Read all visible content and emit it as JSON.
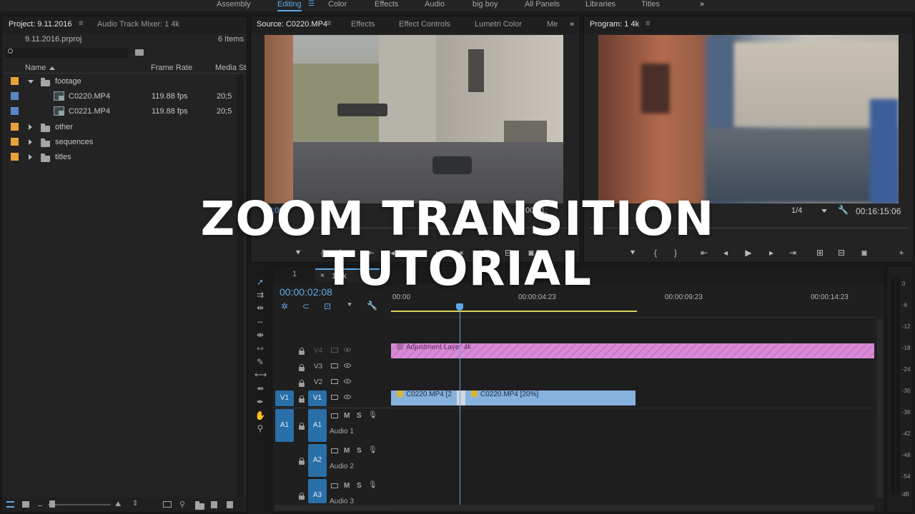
{
  "workspaces": [
    "Assembly",
    "Editing",
    "Color",
    "Effects",
    "Audio",
    "big boy",
    "All Panels",
    "Libraries",
    "Titles"
  ],
  "workspace_active": "Editing",
  "workspace_more": "»",
  "project_panel": {
    "tabs": [
      "Project: 9.11.2016",
      "Audio Track Mixer: 1 4k"
    ],
    "filename": "9.11.2016.prproj",
    "item_count": "6 Items",
    "columns": [
      "Name",
      "Frame Rate",
      "Media St"
    ],
    "items": [
      {
        "name": "footage",
        "type": "bin",
        "color": "#e8a23b",
        "expanded": true
      },
      {
        "name": "C0220.MP4",
        "type": "clip",
        "color": "#5b87c7",
        "fps": "119.88 fps",
        "media_start": "20;5"
      },
      {
        "name": "C0221.MP4",
        "type": "clip",
        "color": "#5b87c7",
        "fps": "119.88 fps",
        "media_start": "20;5"
      },
      {
        "name": "other",
        "type": "bin",
        "color": "#e8a23b"
      },
      {
        "name": "sequences",
        "type": "bin",
        "color": "#e8a23b"
      },
      {
        "name": "titles",
        "type": "bin",
        "color": "#e8a23b"
      }
    ]
  },
  "source_panel": {
    "tabs": [
      "Source: C0220.MP4",
      "Effects",
      "Effect Controls",
      "Lumetri Color",
      "Me"
    ],
    "timecode_left": "00;00;0",
    "timecode_mid": "00;01;"
  },
  "program_panel": {
    "title": "Program: 1 4k",
    "zoom": "1/4",
    "timecode": "00:16:15:06"
  },
  "timeline": {
    "tabs": [
      "1",
      "1 4k"
    ],
    "playhead_timecode": "00:00:02:08",
    "ruler": [
      "00:00",
      "00:00:04:23",
      "00:00:09:23",
      "00:00:14:23"
    ],
    "video_tracks": [
      "V4",
      "V3",
      "V2",
      "V1"
    ],
    "audio_tracks": [
      {
        "id": "A1",
        "name": "Audio 1"
      },
      {
        "id": "A2",
        "name": "Audio 2"
      },
      {
        "id": "A3",
        "name": "Audio 3"
      }
    ],
    "source_patch": {
      "video": "V1",
      "audio": "A1"
    },
    "track_toggles": [
      "M",
      "S"
    ],
    "clips": {
      "adjustment": "Adjustment Layer 4k",
      "clip_a": "C0220.MP4 [2",
      "clip_b": "C0220.MP4 [20%]"
    },
    "colors": {
      "adjustment": "#d98ad6",
      "video_clip": "#86b2de",
      "work_area": "#d9d35a",
      "accent": "#5fa8e8"
    }
  },
  "meter": {
    "ticks": [
      "0",
      "-6",
      "-12",
      "-18",
      "-24",
      "-30",
      "-36",
      "-42",
      "-48",
      "-54",
      "dB"
    ]
  },
  "overlay_title": [
    "ZOOM TRANSITION",
    "TUTORIAL"
  ]
}
